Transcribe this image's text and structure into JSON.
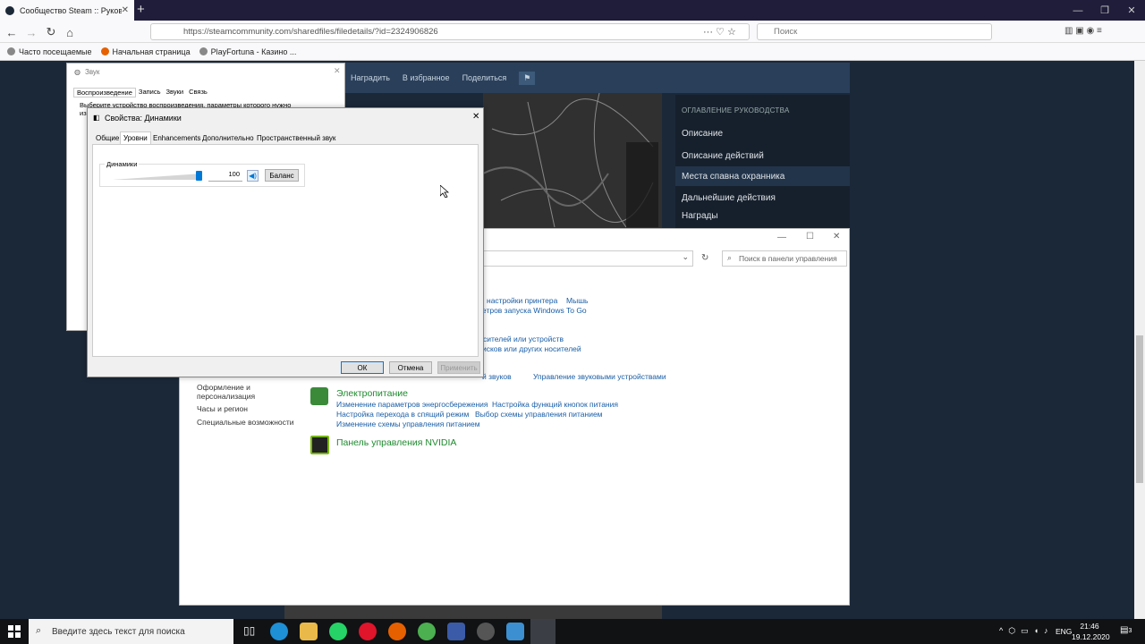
{
  "browser": {
    "tab_title": "Сообщество Steam :: Руководство",
    "url": "https://steamcommunity.com/sharedfiles/filedetails/?id=2324906826",
    "search_placeholder": "Поиск",
    "bookmarks": [
      "Часто посещаемые",
      "Начальная страница",
      "PlayFortuna - Казино ..."
    ]
  },
  "steam": {
    "actions": [
      "Наградить",
      "В избранное",
      "Поделиться"
    ],
    "side_heading": "ОГЛАВЛЕНИЕ РУКОВОДСТВА",
    "side_items": [
      "Описание",
      "Описание действий",
      "Места спавна охранника",
      "Дальнейшие действия",
      "Награды"
    ]
  },
  "sound_dialog": {
    "title": "Звук",
    "tabs": [
      "Воспроизведение",
      "Запись",
      "Звуки",
      "Связь"
    ],
    "instruction": "Выберите устройство воспроизведения, параметры которого нужно",
    "instruction_cont": "из"
  },
  "props_dialog": {
    "title": "Свойства: Динамики",
    "tabs": [
      "Общие",
      "Уровни",
      "Enhancements",
      "Дополнительно",
      "Пространственный звук"
    ],
    "group_label": "Динамики",
    "level_value": "100",
    "level_fraction": 1.0,
    "balance_label": "Баланс",
    "ok_label": "ОК",
    "cancel_label": "Отмена",
    "apply_label": "Применить"
  },
  "control_panel": {
    "search_placeholder": "Поиск в панели управления",
    "links_top1": [
      "настройки принтера",
      "Мышь"
    ],
    "links_top2": "етров запуска Windows To Go",
    "links_mid1": "сителей или устройств",
    "links_mid2": "исков или других носителей",
    "links_sound": [
      "й звуков",
      "Управление звуковыми устройствами"
    ],
    "left_nav": [
      "Оформление и персонализация",
      "Часы и регион",
      "Специальные возможности"
    ],
    "power": {
      "title": "Электропитание",
      "links": [
        "Изменение параметров энергосбережения",
        "Настройка функций кнопок питания",
        "Настройка перехода в спящий режим",
        "Выбор схемы управления питанием",
        "Изменение схемы управления питанием"
      ]
    },
    "nvidia": "Панель управления NVIDIA"
  },
  "taskbar": {
    "search_placeholder": "Введите здесь текст для поиска",
    "lang": "ENG",
    "time": "21:46",
    "date": "19.12.2020",
    "notifications": "3"
  },
  "colors": {
    "accent": "#0078d7",
    "steam_bg": "#1b2838",
    "link": "#1a5ea6",
    "green": "#1e8a2e"
  }
}
